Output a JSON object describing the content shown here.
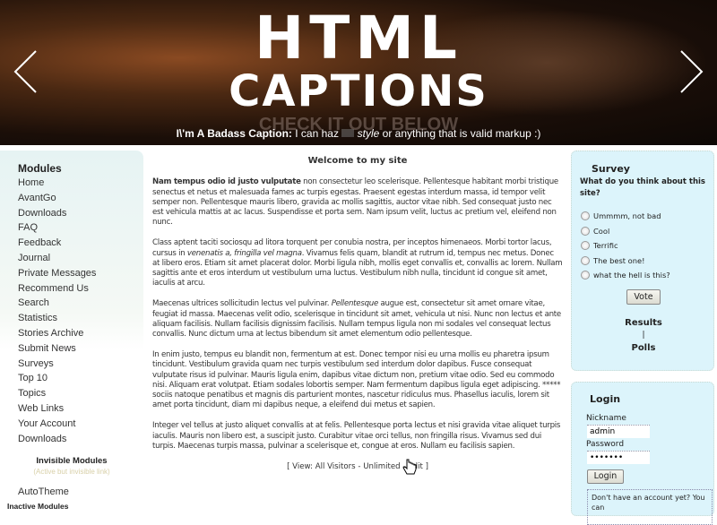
{
  "banner": {
    "title_line1": "HTML",
    "title_line2": "CAPTIONS",
    "ghost_text": "CHECK IT OUT BELOW",
    "caption_bold": "I\\'m A Badass Caption:",
    "caption_pre": "I can haz",
    "caption_italic": "style",
    "caption_post": "or anything that is valid markup :)",
    "prev_icon": "chevron-left",
    "next_icon": "chevron-right"
  },
  "sidebar": {
    "title": "Modules",
    "items": [
      "Home",
      "AvantGo",
      "Downloads",
      "FAQ",
      "Feedback",
      "Journal",
      "Private Messages",
      "Recommend Us",
      "Search",
      "Statistics",
      "Stories Archive",
      "Submit News",
      "Surveys",
      "Top 10",
      "Topics",
      "Web Links",
      "Your Account",
      "Downloads"
    ],
    "invisible_title": "Invisible Modules",
    "invisible_sub": "(Active but invisible link)",
    "invisible_items": [
      "AutoTheme"
    ],
    "inactive_title": "Inactive Modules"
  },
  "main": {
    "title": "Welcome to my site",
    "p1_bold": "Nam tempus odio id justo vulputate",
    "p1": " non consectetur leo scelerisque. Pellentesque habitant morbi tristique senectus et netus et malesuada fames ac turpis egestas. Praesent egestas interdum massa, id tempor velit semper non. Pellentesque mauris libero, gravida ac mollis sagittis, auctor vitae nibh. Sed consequat justo nec est vehicula mattis at ac lacus. Suspendisse et porta sem. Nam ipsum velit, luctus ac pretium vel, eleifend non nunc.",
    "p2a": "Class aptent taciti sociosqu ad litora torquent per conubia nostra, per inceptos himenaeos. Morbi tortor lacus, cursus in ",
    "p2_italic": "venenatis a, fringilla vel magna",
    "p2b": ". Vivamus felis quam, blandit at rutrum id, tempus nec metus. Donec at libero eros. Etiam sit amet placerat dolor. Morbi ligula nibh, mollis eget convallis et, convallis ac lorem. Nullam sagittis ante et eros interdum ut vestibulum urna luctus. Vestibulum nibh nulla, tincidunt id congue sit amet, iaculis at arcu.",
    "p3a": "Maecenas ultrices sollicitudin lectus vel pulvinar. ",
    "p3_italic": "Pellentesque",
    "p3b": " augue est, consectetur sit amet ornare vitae, feugiat id massa. Maecenas velit odio, scelerisque in tincidunt sit amet, vehicula ut nisi. Nunc non lectus et ante aliquam facilisis. Nullam facilisis dignissim facilisis. Nullam tempus ligula non mi sodales vel consequat lectus convallis. Nunc dictum urna at lectus bibendum sit amet elementum odio pellentesque.",
    "p4": "In enim justo, tempus eu blandit non, fermentum at est. Donec tempor nisi eu urna mollis eu pharetra ipsum tincidunt. Vestibulum gravida quam nec turpis vestibulum sed interdum dolor dapibus. Fusce consequat vulputate risus id pulvinar. Mauris ligula enim, dapibus vitae dictum non, pretium vitae odio. Sed eu commodo nisi. Aliquam erat volutpat. Etiam sodales lobortis semper. Nam fermentum dapibus ligula eget adipiscing. ***** sociis natoque penatibus et magnis dis parturient montes, nascetur ridiculus mus. Phasellus iaculis, lorem sit amet porta tincidunt, diam mi dapibus neque, a eleifend dui metus et sapien.",
    "p5": "Integer vel tellus at justo aliquet convallis at at felis. Pellentesque porta lectus et nisi gravida vitae aliquet turpis iaculis. Mauris non libero est, a suscipit justo. Curabitur vitae orci tellus, non fringilla risus. Vivamus sed dui turpis. Maecenas turpis massa, pulvinar a scelerisque et, congue at eros. Nullam eu facilisis sapien.",
    "footer_pre": "[ View: All Visitors - Unlimited - ",
    "footer_edit": "Edit",
    "footer_post": " ]"
  },
  "survey": {
    "title": "Survey",
    "question": "What do you think about this site?",
    "options": [
      "Ummmm, not bad",
      "Cool",
      "Terrific",
      "The best one!",
      "what the hell is this?"
    ],
    "vote": "Vote",
    "results": "Results",
    "separator": "|",
    "polls": "Polls"
  },
  "login": {
    "title": "Login",
    "nickname_label": "Nickname",
    "nickname_value": "admin",
    "password_label": "Password",
    "password_value": "•••••••",
    "button": "Login",
    "note": "Don't have an account yet? You can"
  }
}
